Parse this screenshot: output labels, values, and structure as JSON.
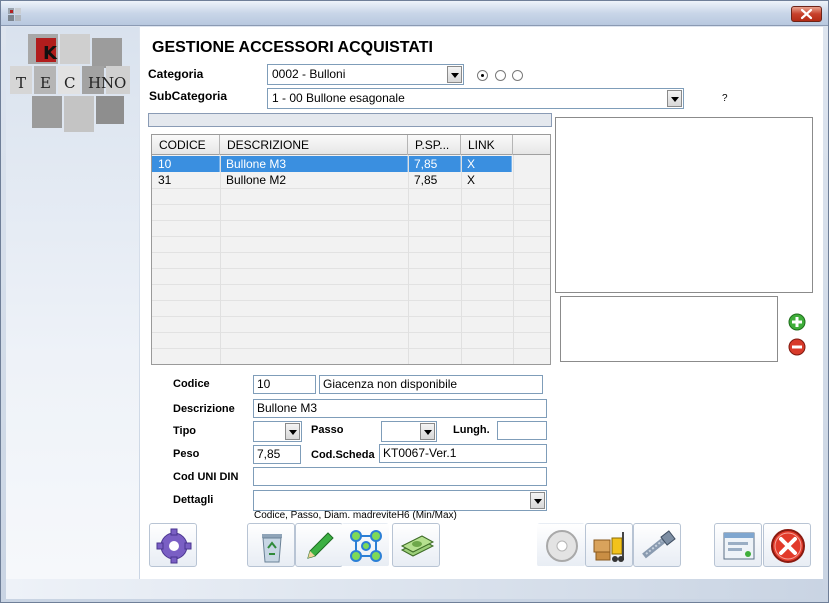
{
  "window": {
    "title": ""
  },
  "header": {
    "title": "GESTIONE ACCESSORI ACQUISTATI",
    "logo_letters": [
      "K",
      "T",
      "E",
      "C",
      "H",
      "N",
      "O"
    ]
  },
  "filters": {
    "categoria_label": "Categoria",
    "categoria_value": "0002 - Bulloni",
    "subcategoria_label": "SubCategoria",
    "subcategoria_value": "1 - 00 Bullone esagonale",
    "radio_selected_index": 0,
    "help_text": "?"
  },
  "grid": {
    "columns": [
      "CODICE",
      "DESCRIZIONE",
      "P.SP...",
      "LINK"
    ],
    "rows": [
      {
        "codice": "10",
        "descrizione": "Bullone M3",
        "prezzo": "7,85",
        "link": "X",
        "selected": true
      },
      {
        "codice": "31",
        "descrizione": "Bullone M2",
        "prezzo": "7,85",
        "link": "X",
        "selected": false
      }
    ]
  },
  "form": {
    "codice_label": "Codice",
    "codice_value": "10",
    "giacenza_value": "Giacenza non disponibile",
    "descrizione_label": "Descrizione",
    "descrizione_value": "Bullone M3",
    "tipo_label": "Tipo",
    "tipo_value": "",
    "passo_label": "Passo",
    "passo_value": "",
    "lungh_label": "Lungh.",
    "lungh_value": "",
    "peso_label": "Peso",
    "peso_value": "7,85",
    "codscheda_label": "Cod.Scheda",
    "codscheda_value": "KT0067-Ver.1",
    "coduni_label": "Cod UNI DIN",
    "coduni_value": "",
    "dettagli_label": "Dettagli",
    "dettagli_value": "",
    "hint": "Codice, Passo, Diam. madreviteH6 (Min/Max)"
  },
  "toolbar": {
    "icons": [
      "gear-icon",
      "recycle-bin-icon",
      "pencil-icon",
      "molecule-icon",
      "money-icon",
      "disc-icon",
      "forklift-icon",
      "bolt-icon",
      "window-icon",
      "exit-icon"
    ]
  },
  "colors": {
    "selection": "#3a8fe0",
    "window_bg": "#d6dde8"
  }
}
